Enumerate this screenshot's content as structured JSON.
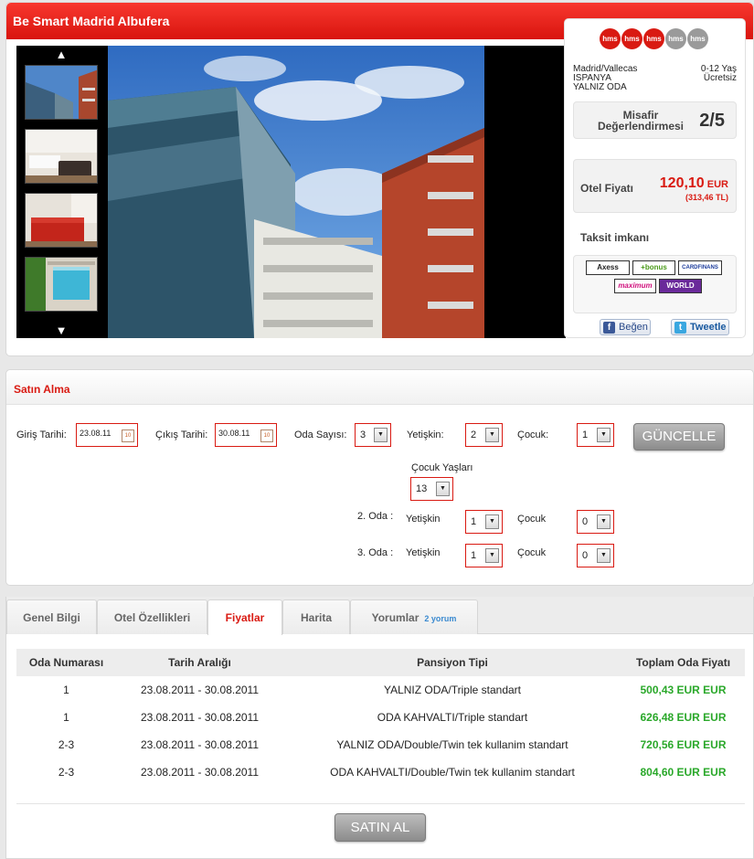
{
  "hotel": {
    "name": "Be Smart Madrid Albufera",
    "star_badges": [
      {
        "label": "hms",
        "active": true
      },
      {
        "label": "hms",
        "active": true
      },
      {
        "label": "hms",
        "active": true
      },
      {
        "label": "hms",
        "active": false
      },
      {
        "label": "hms",
        "active": false
      }
    ],
    "location_line1": "Madrid/Vallecas",
    "location_line2": "ISPANYA",
    "board": "YALNIZ ODA",
    "child_age": "0-12 Yaş",
    "child_fee": "Ücretsiz",
    "rating_label_line1": "Misafir",
    "rating_label_line2": "Değerlendirmesi",
    "rating": "2/5",
    "price_label": "Otel Fiyatı",
    "price_value": "120,10",
    "price_currency": "EUR",
    "price_tl": "(313,46 TL)",
    "installment_label": "Taksit imkanı",
    "cards": [
      "Axess",
      "+bonus",
      "CARDFINANS",
      "maximum",
      "WORLD"
    ],
    "like_label": "Beğen",
    "tweet_label": "Tweetle"
  },
  "purchase": {
    "title": "Satın Alma",
    "checkin_label": "Giriş Tarihi:",
    "checkin_value": "23.08.11",
    "checkout_label": "Çıkış Tarihi:",
    "checkout_value": "30.08.11",
    "rooms_label": "Oda Sayısı:",
    "rooms_value": "3",
    "adults_label": "Yetişkin:",
    "children_label": "Çocuk:",
    "update_button": "GÜNCELLE",
    "child_ages_label": "Çocuk Yaşları",
    "child_age_value": "13",
    "room1": {
      "adults": "2",
      "children": "1"
    },
    "room2": {
      "label": "2. Oda :",
      "adults_label": "Yetişkin",
      "adults": "1",
      "children_label": "Çocuk",
      "children": "0"
    },
    "room3": {
      "label": "3. Oda :",
      "adults_label": "Yetişkin",
      "adults": "1",
      "children_label": "Çocuk",
      "children": "0"
    }
  },
  "tabs": {
    "general": "Genel Bilgi",
    "features": "Otel Özellikleri",
    "prices": "Fiyatlar",
    "map": "Harita",
    "reviews": "Yorumlar",
    "review_count": "2 yorum"
  },
  "price_table": {
    "headers": [
      "Oda Numarası",
      "Tarih Aralığı",
      "Pansiyon Tipi",
      "Toplam Oda Fiyatı"
    ],
    "rows": [
      {
        "room": "1",
        "dates": "23.08.2011 - 30.08.2011",
        "board": "YALNIZ ODA/Triple standart",
        "price": "500,43 EUR EUR"
      },
      {
        "room": "1",
        "dates": "23.08.2011 - 30.08.2011",
        "board": "ODA KAHVALTI/Triple standart",
        "price": "626,48 EUR EUR"
      },
      {
        "room": "2-3",
        "dates": "23.08.2011 - 30.08.2011",
        "board": "YALNIZ ODA/Double/Twin tek kullanim standart",
        "price": "720,56 EUR EUR"
      },
      {
        "room": "2-3",
        "dates": "23.08.2011 - 30.08.2011",
        "board": "ODA KAHVALTI/Double/Twin tek kullanim standart",
        "price": "804,60 EUR EUR"
      }
    ]
  },
  "buy_button": "SATIN AL",
  "colors": {
    "accent_red": "#d91a12",
    "price_green": "#2aa82a",
    "link_blue": "#3a8ad0"
  }
}
